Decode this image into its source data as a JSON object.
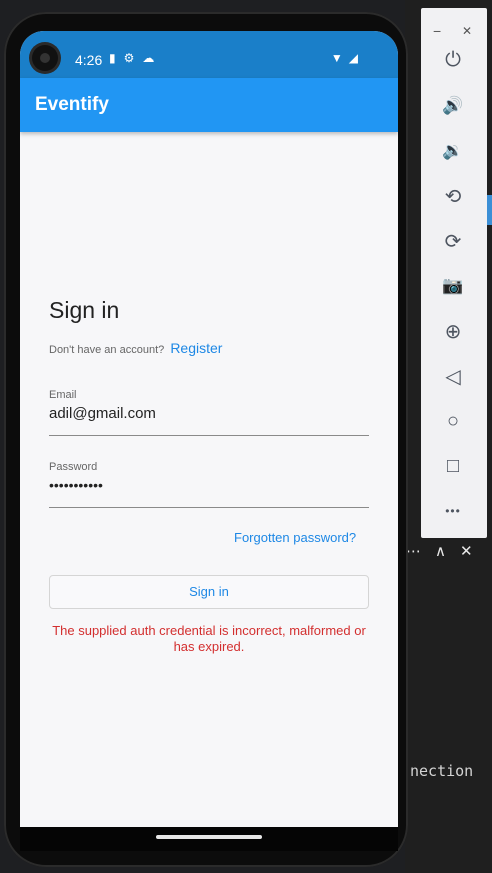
{
  "device": {
    "time": "4:26"
  },
  "appbar": {
    "title": "Eventify"
  },
  "signin": {
    "title": "Sign in",
    "no_account_text": "Don't have an account?",
    "register_link": "Register",
    "email_label": "Email",
    "email_value": "adil@gmail.com",
    "password_label": "Password",
    "password_value": "•••••••••••",
    "forgot_link": "Forgotten password?",
    "signin_button": "Sign in",
    "error_message": "The supplied auth credential is incorrect, malformed or has expired."
  },
  "emulator_toolbar": {
    "minimize": "−",
    "close": "✕",
    "buttons": [
      {
        "name": "power-icon",
        "glyph": "⏻"
      },
      {
        "name": "volume-up-icon",
        "glyph": "🔊"
      },
      {
        "name": "volume-down-icon",
        "glyph": "🔉"
      },
      {
        "name": "rotate-left-icon",
        "glyph": "⟲"
      },
      {
        "name": "rotate-right-icon",
        "glyph": "⟳"
      },
      {
        "name": "camera-icon",
        "glyph": "📷"
      },
      {
        "name": "zoom-icon",
        "glyph": "⊕"
      },
      {
        "name": "back-icon",
        "glyph": "◁"
      },
      {
        "name": "home-icon",
        "glyph": "○"
      },
      {
        "name": "overview-icon",
        "glyph": "□"
      },
      {
        "name": "more-icon",
        "glyph": "•••"
      }
    ]
  },
  "ide": {
    "partial_text": "nection",
    "controls": [
      "⋯",
      "∧",
      "✕"
    ]
  },
  "colors": {
    "primary": "#2196f3",
    "status_bar": "#1a7fc9",
    "error": "#d32f2f",
    "link": "#1e88e5"
  }
}
